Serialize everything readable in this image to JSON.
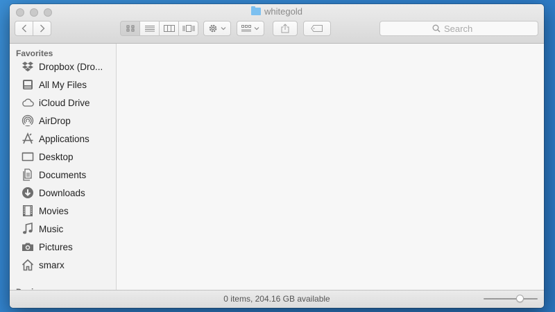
{
  "window": {
    "title": "whitegold"
  },
  "toolbar": {
    "back_icon": "chevron-left-icon",
    "forward_icon": "chevron-right-icon",
    "views": [
      "icon-view-icon",
      "list-view-icon",
      "column-view-icon",
      "coverflow-view-icon"
    ],
    "active_view": 0,
    "search_placeholder": "Search"
  },
  "sidebar": {
    "favorites_title": "Favorites",
    "items": [
      {
        "label": "Dropbox (Dro...",
        "icon": "dropbox-icon"
      },
      {
        "label": "All My Files",
        "icon": "all-files-icon"
      },
      {
        "label": "iCloud Drive",
        "icon": "cloud-icon"
      },
      {
        "label": "AirDrop",
        "icon": "airdrop-icon"
      },
      {
        "label": "Applications",
        "icon": "applications-icon"
      },
      {
        "label": "Desktop",
        "icon": "desktop-icon"
      },
      {
        "label": "Documents",
        "icon": "documents-icon"
      },
      {
        "label": "Downloads",
        "icon": "downloads-icon"
      },
      {
        "label": "Movies",
        "icon": "movies-icon"
      },
      {
        "label": "Music",
        "icon": "music-icon"
      },
      {
        "label": "Pictures",
        "icon": "camera-icon"
      },
      {
        "label": "smarx",
        "icon": "home-icon"
      }
    ],
    "devices_title": "Devices"
  },
  "status": {
    "text": "0 items, 204.16 GB available",
    "zoom_level": 0.7
  },
  "colors": {
    "icon_gray": "#6e6e6e",
    "folder_blue": "#7cc0f0"
  }
}
